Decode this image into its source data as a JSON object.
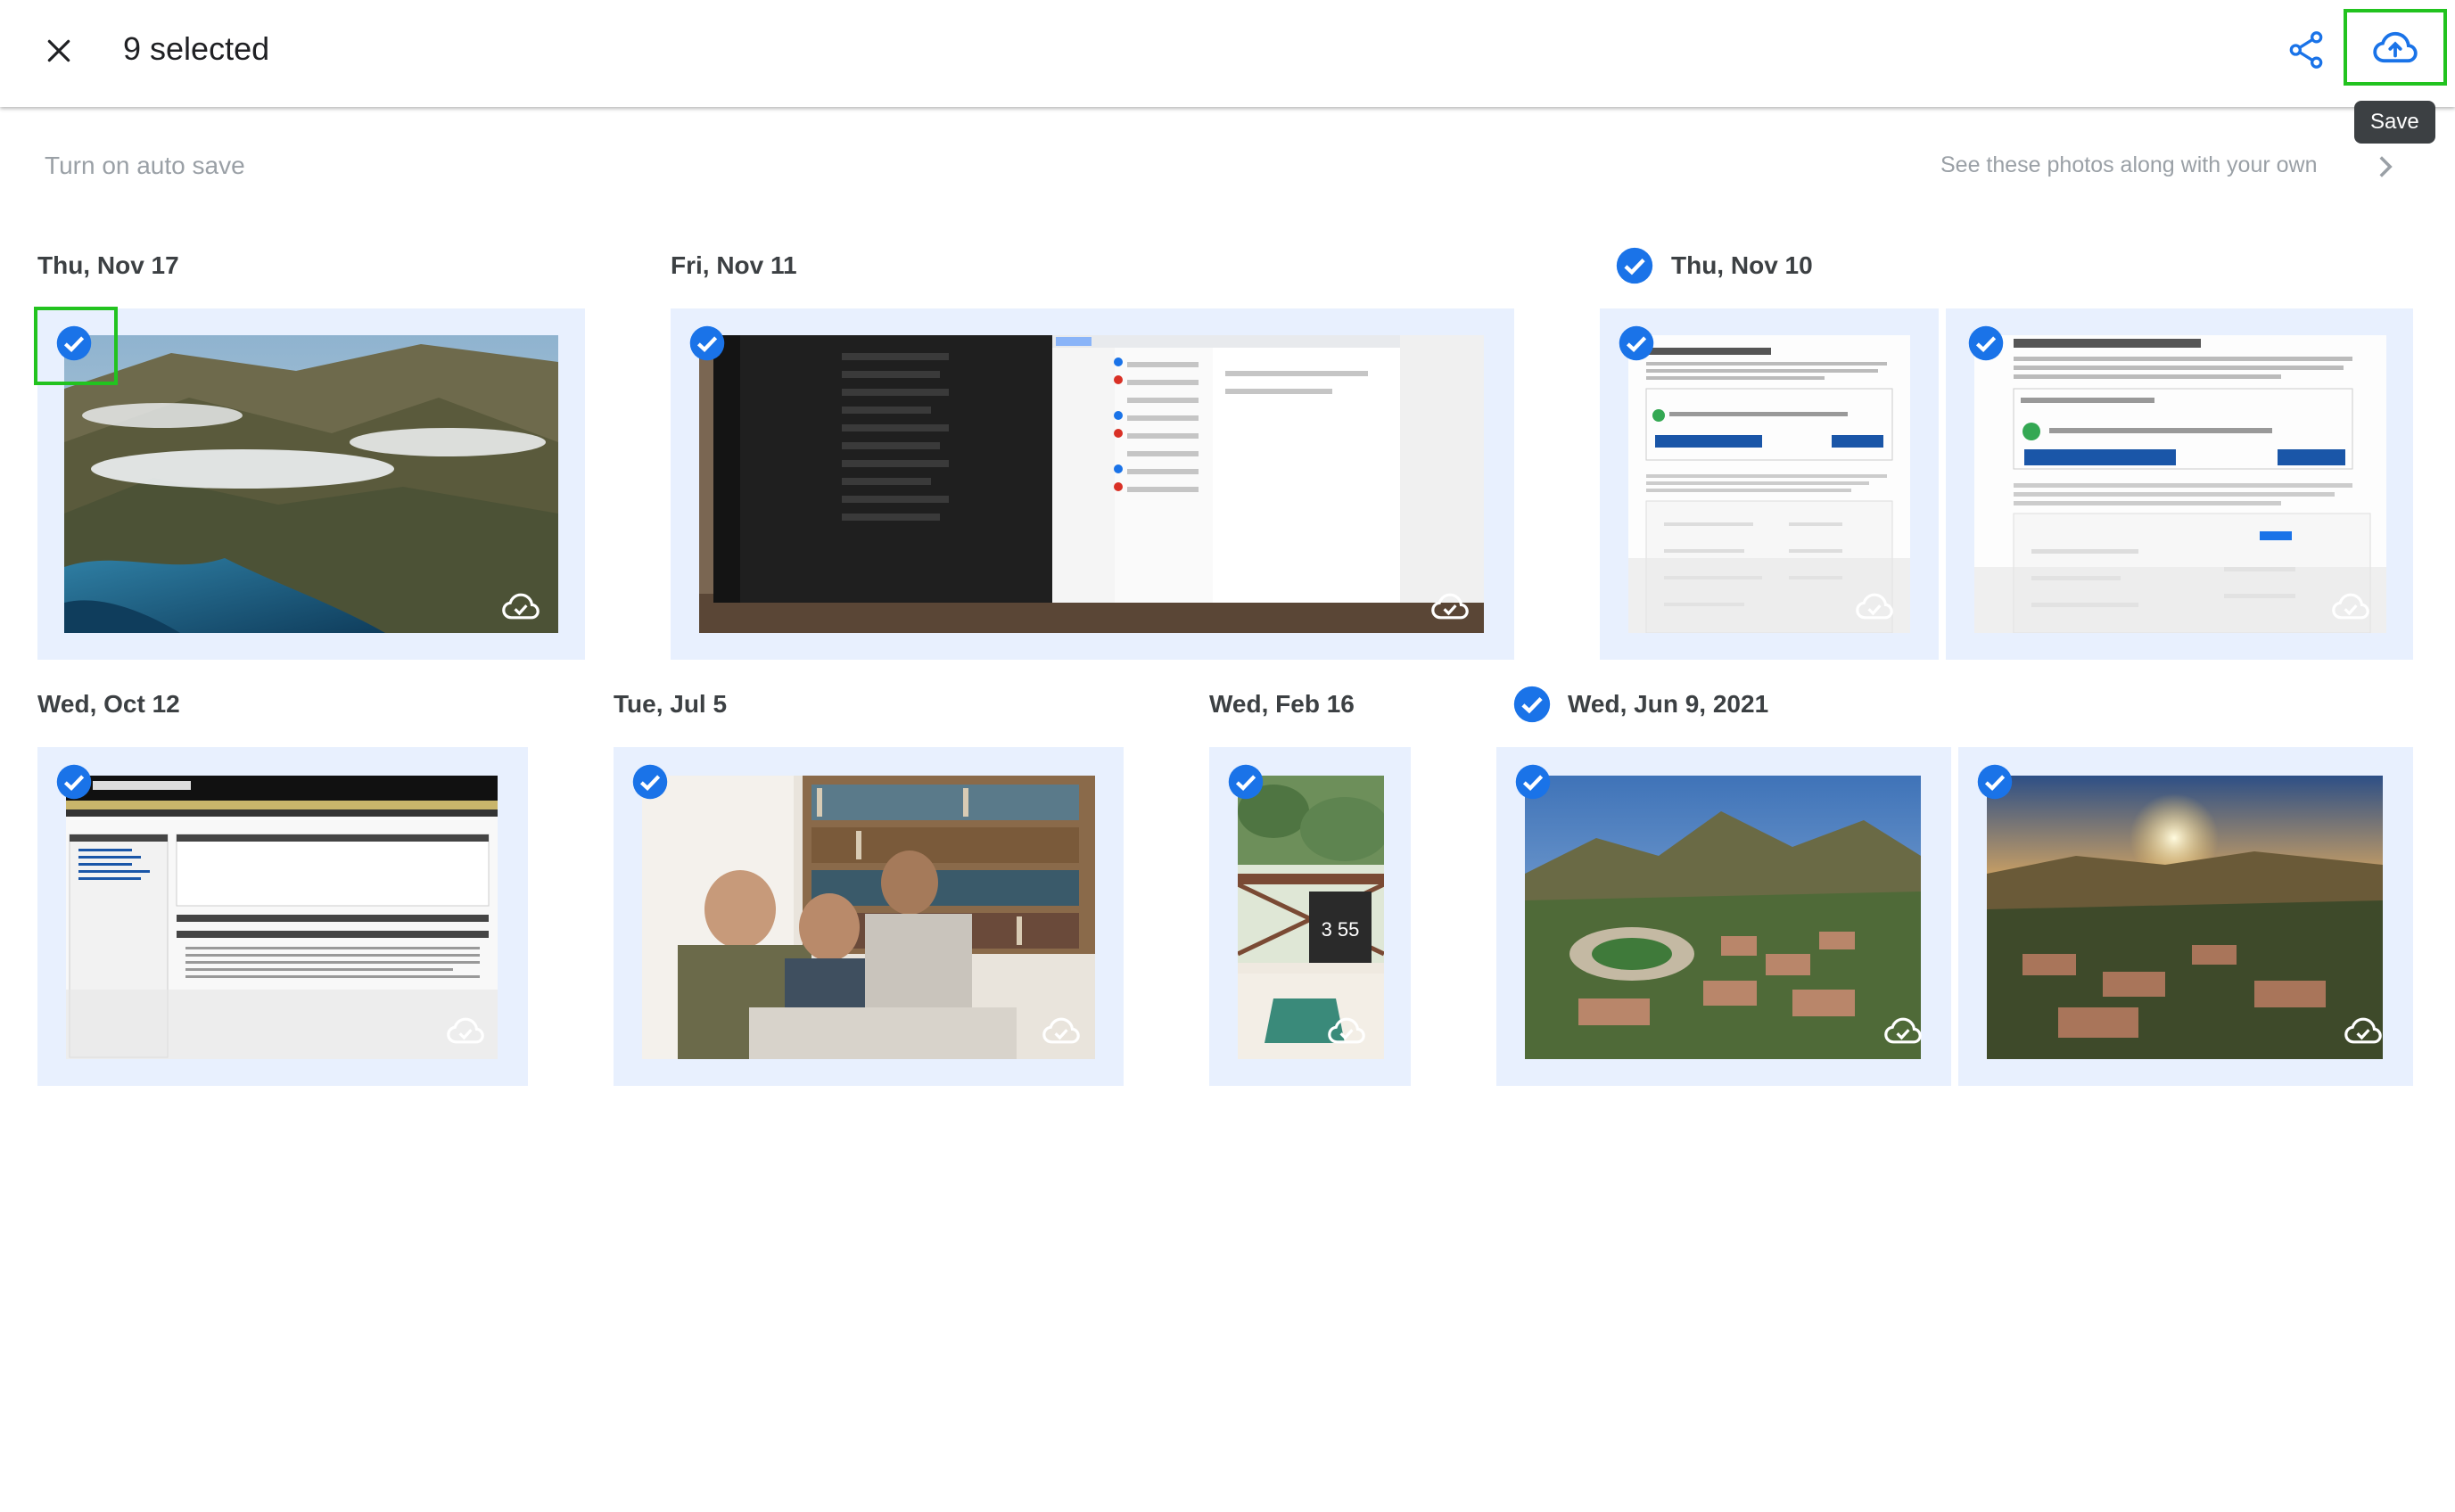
{
  "header": {
    "selected_text": "9 selected",
    "close_icon": "close-icon",
    "share_icon": "share-icon",
    "save_icon": "cloud-upload-icon",
    "save_tooltip": "Save"
  },
  "banner": {
    "auto_save": "Turn on auto save",
    "see_photos": "See these photos along with your own"
  },
  "colors": {
    "accent": "#1a73e8",
    "selection_bg": "#e8f0fe",
    "highlight": "#22c31f"
  },
  "groups": [
    {
      "date": "Thu, Nov 17"
    },
    {
      "date": "Fri, Nov 11"
    },
    {
      "date": "Thu, Nov 10"
    },
    {
      "date": "Wed, Oct 12"
    },
    {
      "date": "Tue, Jul 5"
    },
    {
      "date": "Wed, Feb 16"
    },
    {
      "date": "Wed, Jun 9, 2021"
    }
  ],
  "photos": [
    {
      "name": "coastal-mountains-photo",
      "selected": true
    },
    {
      "name": "desktop-screenshot-photo",
      "selected": true
    },
    {
      "name": "text-notifications-screenshot-photo",
      "selected": true
    },
    {
      "name": "text-notifications-detail-photo",
      "selected": true
    },
    {
      "name": "student-employment-page-photo",
      "selected": true
    },
    {
      "name": "library-team-photo",
      "selected": true
    },
    {
      "name": "laptop-plant-photo",
      "selected": true
    },
    {
      "name": "campus-aerial-photo",
      "selected": true
    },
    {
      "name": "campus-sunset-photo",
      "selected": true
    }
  ]
}
